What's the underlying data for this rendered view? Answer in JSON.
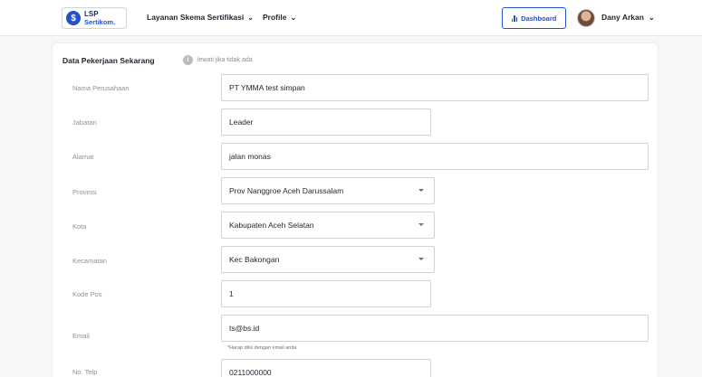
{
  "header": {
    "logo": {
      "line1": "LSP",
      "line2": "Sertikom.",
      "mark": "$"
    },
    "nav": [
      {
        "label": "Layanan Skema Sertifikasi"
      },
      {
        "label": "Profile"
      }
    ],
    "dashboard_label": "Dashboard",
    "user_name": "Dany Arkan"
  },
  "section": {
    "title": "Data Pekerjaan Sekarang",
    "hint": "lewati jika tidak ada"
  },
  "form": {
    "nama_perusahaan": {
      "label": "Nama Perusahaan",
      "value": "PT YMMA test simpan"
    },
    "jabatan": {
      "label": "Jabatan",
      "value": "Leader"
    },
    "alamat": {
      "label": "Alamat",
      "value": "jalan monas"
    },
    "provinsi": {
      "label": "Provinsi",
      "value": "Prov Nanggroe Aceh Darussalam"
    },
    "kota": {
      "label": "Kota",
      "value": "Kabupaten Aceh Selatan"
    },
    "kecamatan": {
      "label": "Kecamatan",
      "value": "Kec Bakongan"
    },
    "kode_pos": {
      "label": "Kode Pos",
      "value": "1"
    },
    "email": {
      "label": "Email",
      "value": "ts@bs.id",
      "helper": "*Harap diisi dengan email anda"
    },
    "telp": {
      "label": "No. Telp",
      "value": "0211000000"
    }
  },
  "colors": {
    "brand": "#2451c7",
    "border": "#cfd2d8",
    "label": "#8c9099"
  },
  "icons": [
    "info-icon",
    "chevron-down-icon",
    "bar-chart-icon",
    "dropdown-caret-icon"
  ]
}
